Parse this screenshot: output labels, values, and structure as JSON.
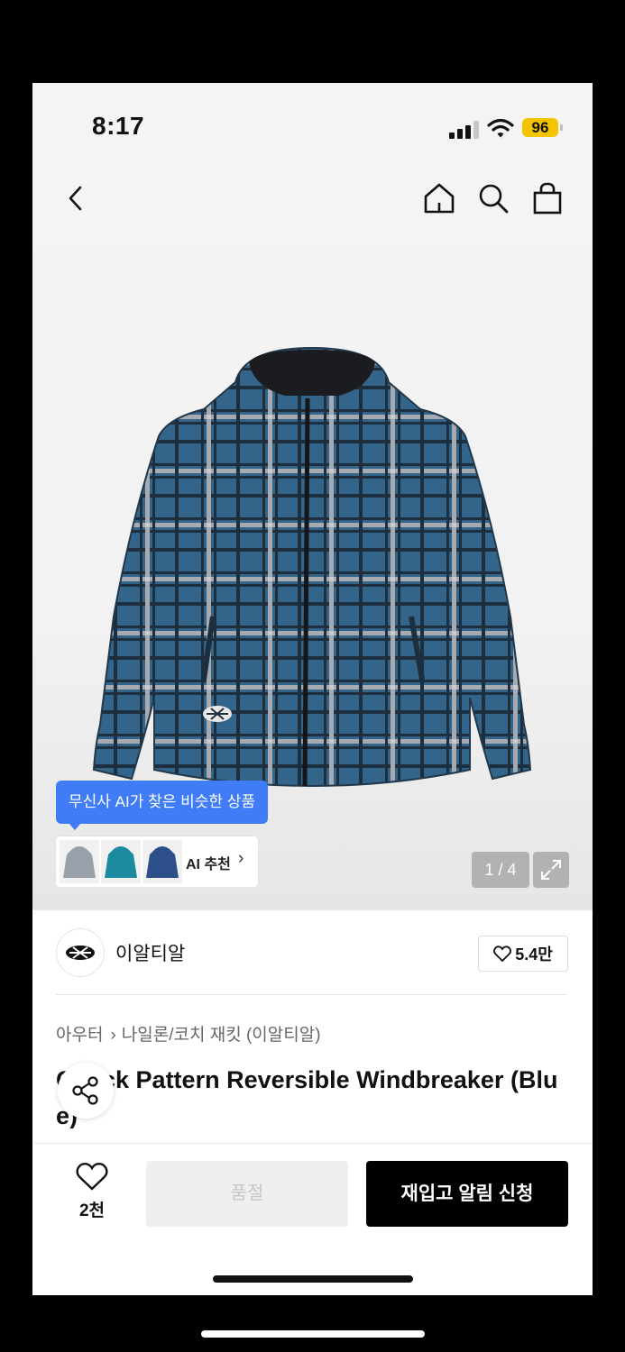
{
  "status_bar": {
    "time": "8:17",
    "battery": "96"
  },
  "nav": {
    "back_icon": "chevron-left-icon",
    "home_icon": "home-icon",
    "search_icon": "search-icon",
    "bag_icon": "shopping-bag-icon"
  },
  "gallery": {
    "ai_tooltip": "무신사 AI가 찾은 비슷한 상품",
    "ai_label": "AI 추천",
    "page_indicator": "1 / 4",
    "expand_icon": "expand-icon"
  },
  "brand": {
    "name": "이알티알",
    "likes": "5.4만"
  },
  "product": {
    "breadcrumb": [
      "아우터",
      "나일론/코치 재킷 (이알티알)"
    ],
    "title": "Check Pattern Reversible Windbreaker (Blue)"
  },
  "bottom": {
    "wish_count": "2천",
    "soldout_label": "품절",
    "restock_label": "재입고 알림 신청"
  },
  "colors": {
    "accent_blue": "#3f7cf5",
    "battery_yellow": "#f5c400",
    "jacket_blue": "#33658a",
    "cta_black": "#000000"
  }
}
